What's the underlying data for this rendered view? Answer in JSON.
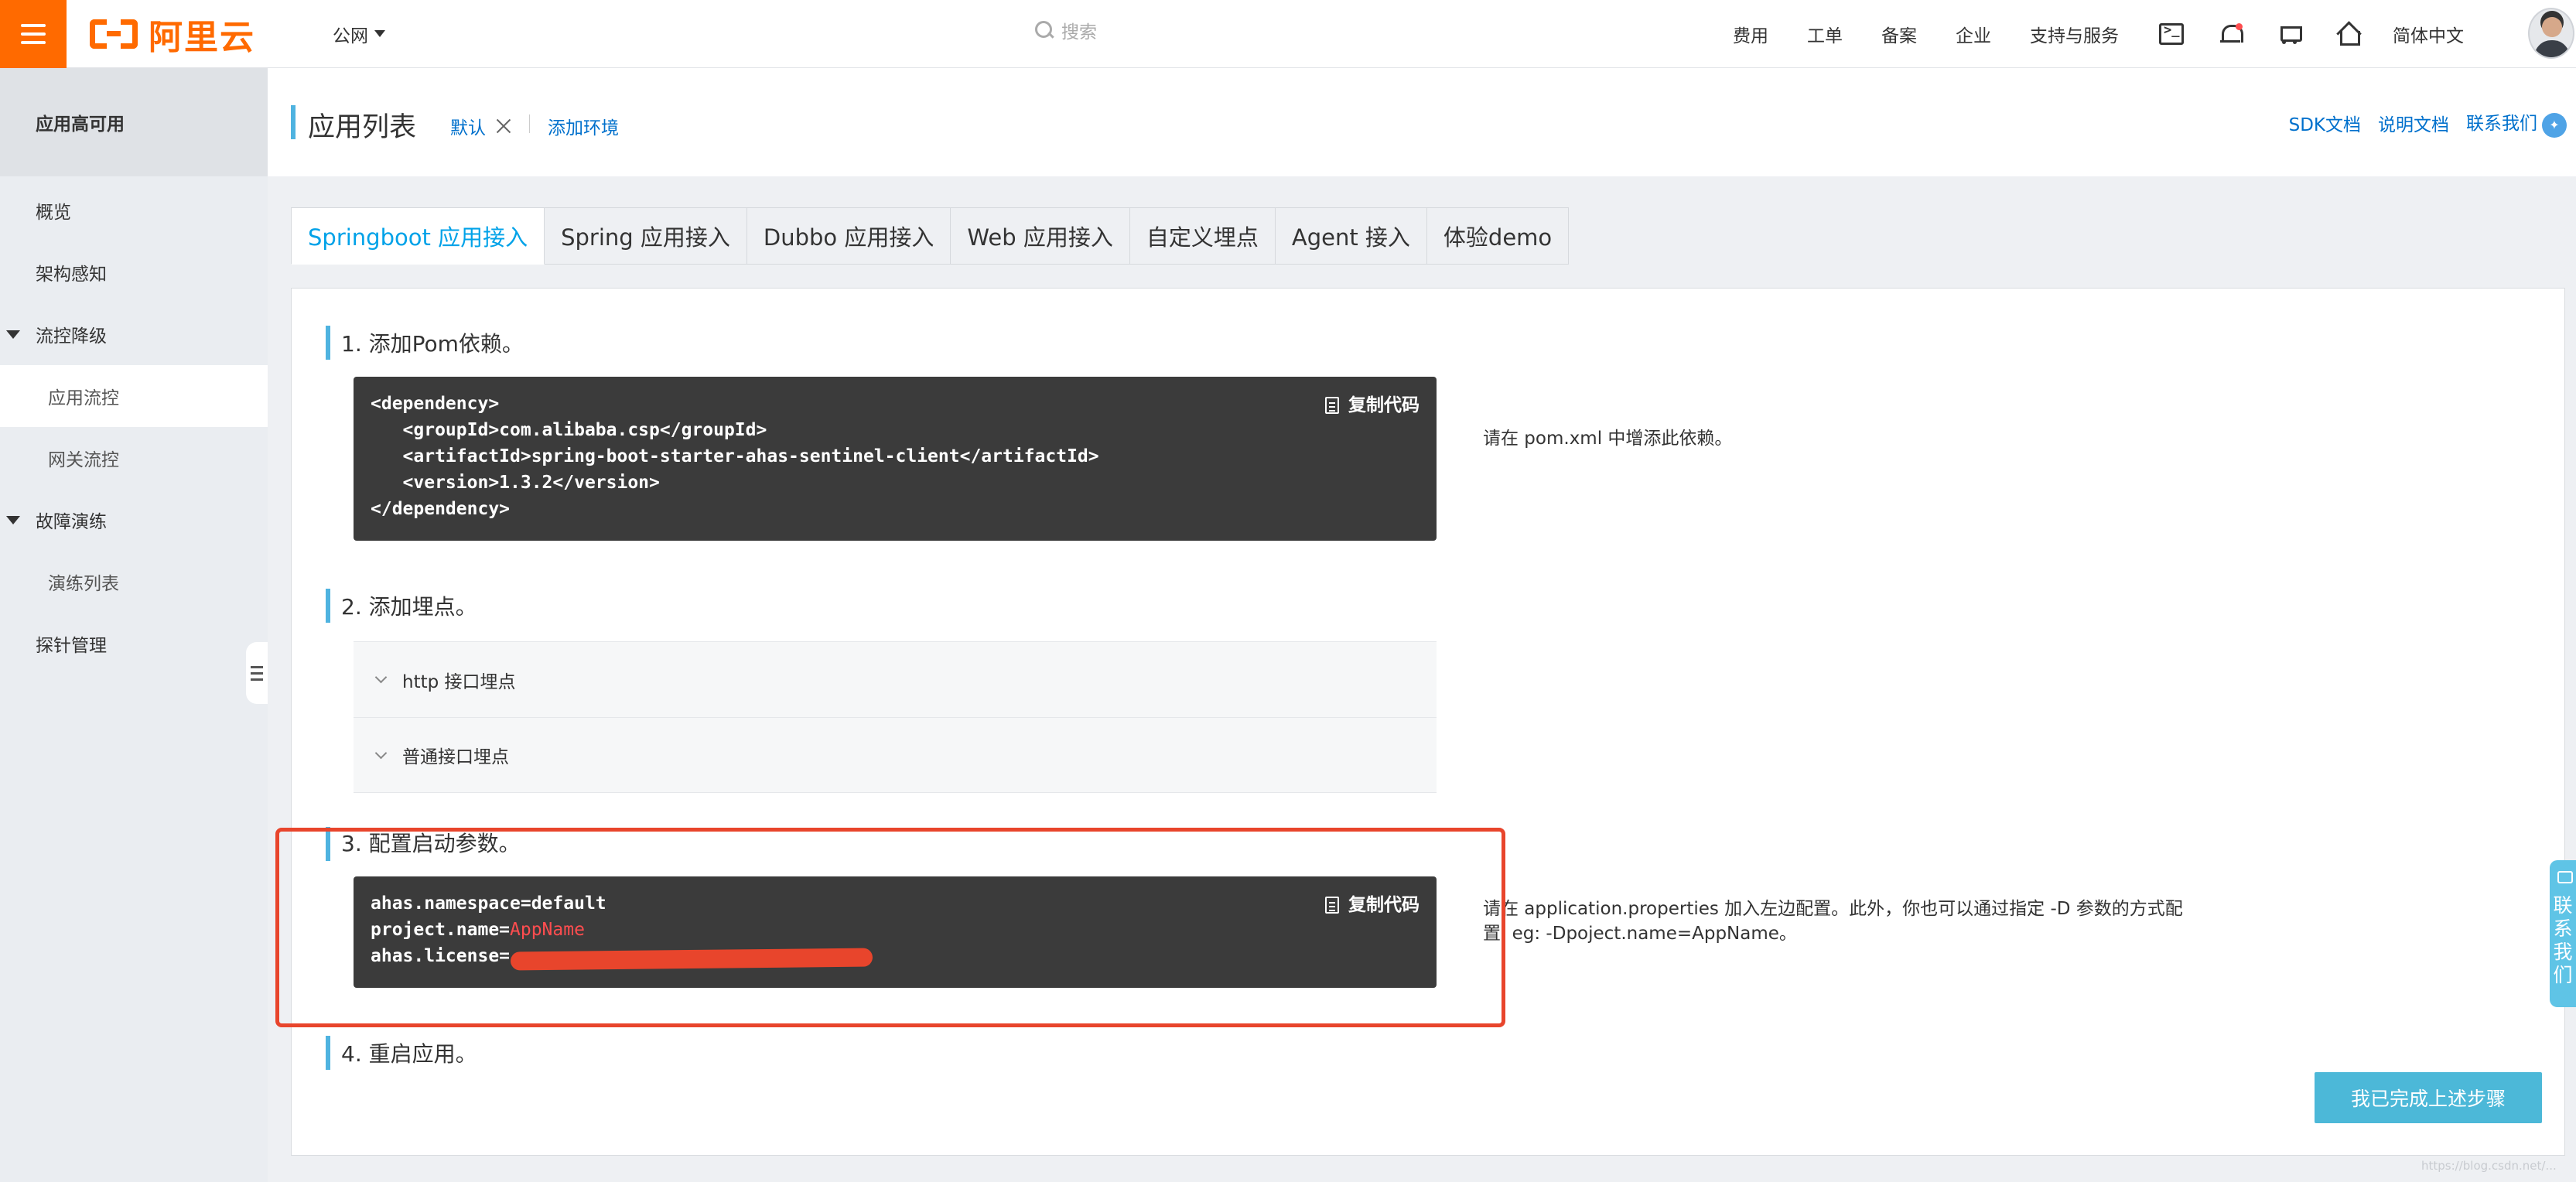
{
  "topbar": {
    "logo_text": "阿里云",
    "region": "公网",
    "search_placeholder": "搜索",
    "nav": [
      "费用",
      "工单",
      "备案",
      "企业",
      "支持与服务"
    ],
    "language": "简体中文",
    "icons": [
      "terminal-icon",
      "bell-icon",
      "cart-icon",
      "home-icon"
    ]
  },
  "sidebar": {
    "title": "应用高可用",
    "items": [
      {
        "label": "概览"
      },
      {
        "label": "架构感知"
      },
      {
        "label": "流控降级"
      },
      {
        "label": "应用流控"
      },
      {
        "label": "网关流控"
      },
      {
        "label": "故障演练"
      },
      {
        "label": "演练列表"
      },
      {
        "label": "探针管理"
      }
    ]
  },
  "header": {
    "title": "应用列表",
    "env": "默认",
    "add_env": "添加环境",
    "links": [
      "SDK文档",
      "说明文档",
      "联系我们"
    ]
  },
  "tabs": [
    "Springboot 应用接入",
    "Spring 应用接入",
    "Dubbo 应用接入",
    "Web 应用接入",
    "自定义埋点",
    "Agent 接入",
    "体验demo"
  ],
  "steps": {
    "s1": {
      "title": "1. 添加Pom依赖。",
      "copy": "复制代码",
      "code": [
        "<dependency>",
        "   <groupId>com.alibaba.csp</groupId>",
        "   <artifactId>spring-boot-starter-ahas-sentinel-client</artifactId>",
        "   <version>1.3.2</version>",
        "</dependency>"
      ],
      "note": "请在 pom.xml 中增添此依赖。"
    },
    "s2": {
      "title": "2. 添加埋点。",
      "items": [
        "http 接口埋点",
        "普通接口埋点"
      ]
    },
    "s3": {
      "title": "3. 配置启动参数。",
      "copy": "复制代码",
      "code": {
        "line1": "ahas.namespace=default",
        "line2_key": "project.name=",
        "line2_val": "AppName",
        "line3_key": "ahas.license="
      },
      "note_line1": "请在 application.properties 加入左边配置。此外，你也可以通过指定 -D 参数的方式配",
      "note_line2": "置, eg: -Dpoject.name=AppName。"
    },
    "s4": {
      "title": "4. 重启应用。"
    }
  },
  "done_button": "我已完成上述步骤",
  "contact_float": [
    "联",
    "系",
    "我",
    "们"
  ],
  "watermark": "https://blog.csdn.net/...",
  "colors": {
    "brand": "#ff6a00",
    "link": "#0070cc",
    "tab_active": "#00a2e8",
    "step_accent": "#4fb3e0",
    "code_bg": "#3b3b3b",
    "highlight_box": "#e8452c",
    "done_button": "#4cb8d8"
  }
}
